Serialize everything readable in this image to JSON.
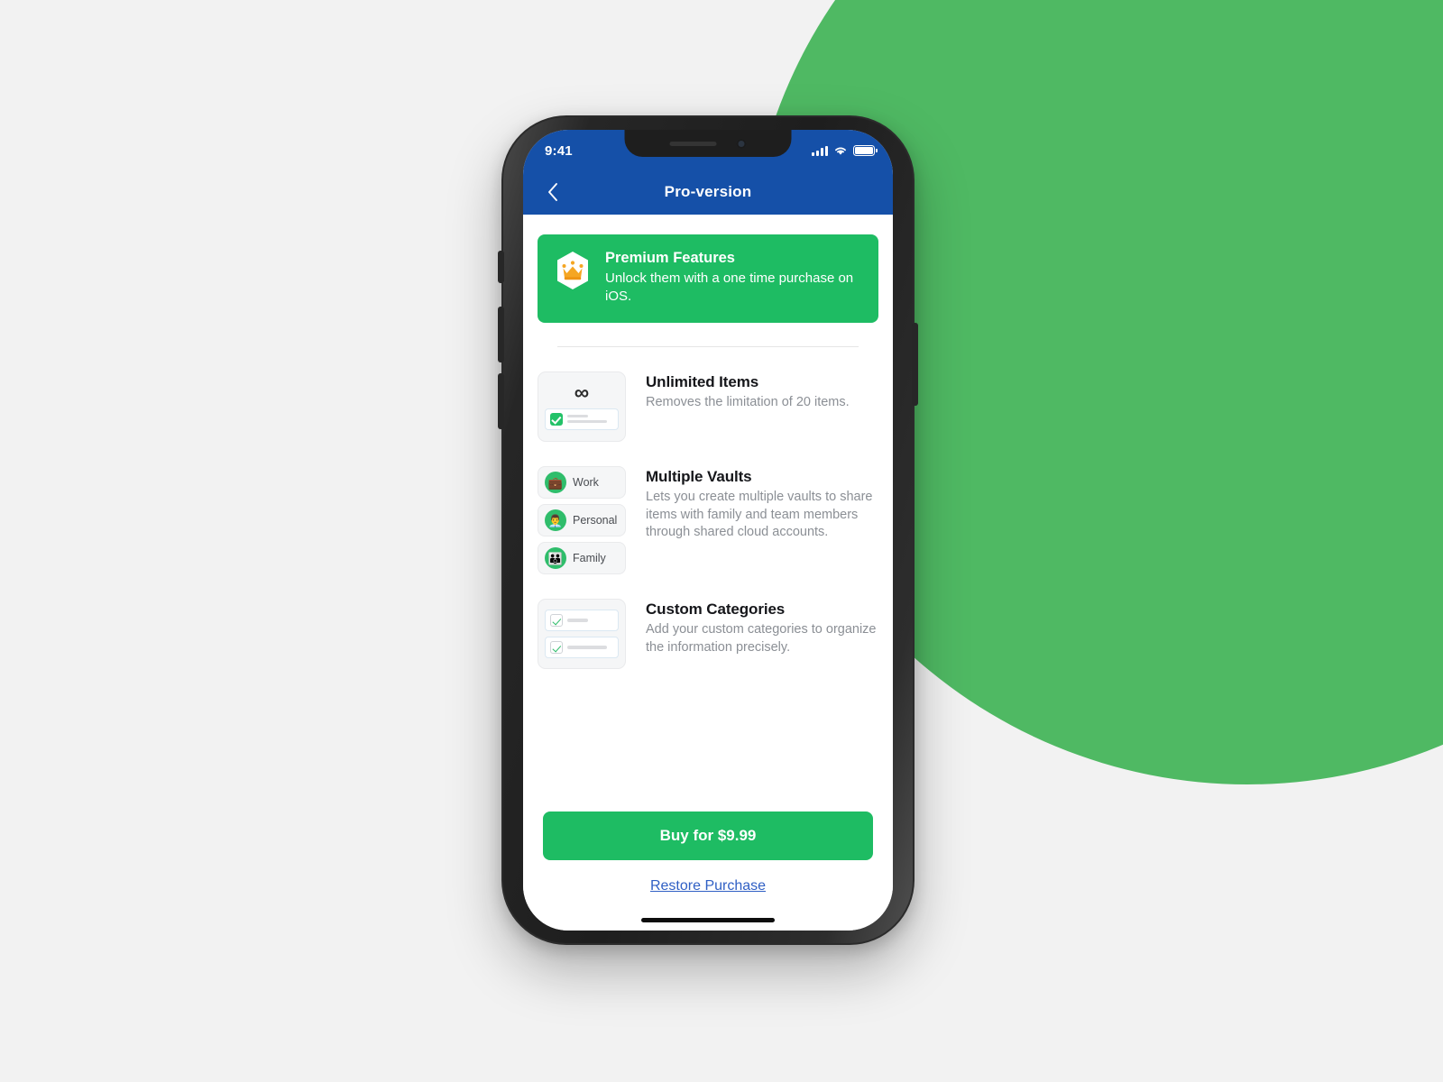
{
  "status_bar": {
    "time": "9:41",
    "cellular_icon": "signal-bars-icon",
    "wifi_icon": "wifi-icon",
    "battery_icon": "battery-full-icon"
  },
  "nav": {
    "back_icon": "chevron-left-icon",
    "title": "Pro-version"
  },
  "promo": {
    "icon": "crown-hexagon-icon",
    "title": "Premium Features",
    "subtitle": "Unlock them with a one time purchase on iOS."
  },
  "features": [
    {
      "id": "unlimited-items",
      "icon": "infinity-list-icon",
      "infinity_glyph": "∞",
      "title": "Unlimited Items",
      "description": "Removes the limitation of 20 items."
    },
    {
      "id": "multiple-vaults",
      "icon": "vault-chips-icon",
      "title": "Multiple Vaults",
      "description": "Lets you create multiple vaults to share items with family and team members through shared cloud accounts.",
      "vaults": [
        {
          "label": "Work",
          "avatar_icon": "briefcase-icon",
          "glyph": "💼"
        },
        {
          "label": "Personal",
          "avatar_icon": "person-icon",
          "glyph": "👨‍💼"
        },
        {
          "label": "Family",
          "avatar_icon": "family-icon",
          "glyph": "👪"
        }
      ]
    },
    {
      "id": "custom-categories",
      "icon": "checkbox-list-icon",
      "title": "Custom Categories",
      "description": "Add your custom categories to organize the information precisely."
    }
  ],
  "footer": {
    "buy_label": "Buy for $9.99",
    "restore_label": "Restore Purchase"
  },
  "colors": {
    "nav_blue": "#1550a8",
    "accent_green": "#1ebc63",
    "background_green": "#4fb963",
    "page_background": "#f2f2f2",
    "link_blue": "#2f5fc4",
    "crown_orange": "#f5a623"
  }
}
